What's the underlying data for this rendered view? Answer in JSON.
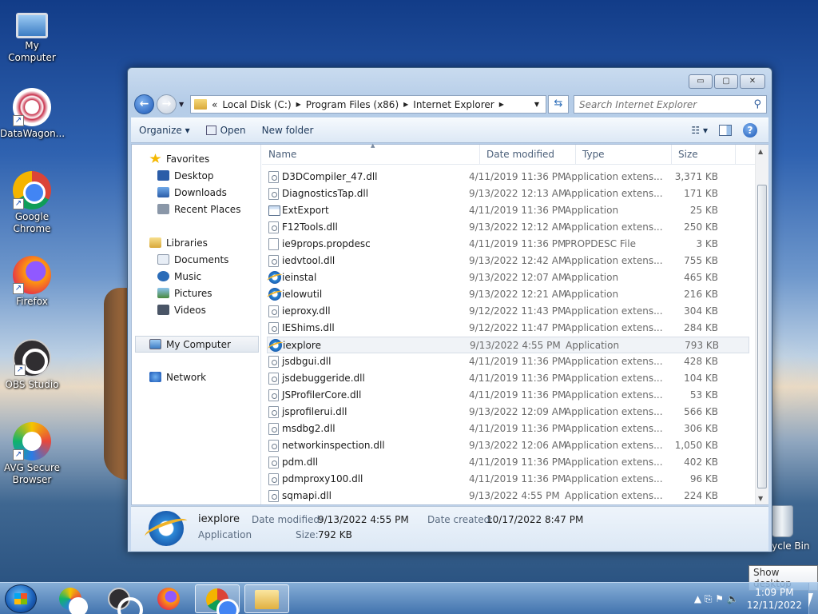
{
  "desktop": {
    "icons": [
      {
        "label": "My Computer"
      },
      {
        "label": "DataWagon..."
      },
      {
        "label": "Google Chrome"
      },
      {
        "label": "Firefox"
      },
      {
        "label": "OBS Studio"
      },
      {
        "label": "AVG Secure Browser"
      }
    ],
    "recycle_bin": "Recycle Bin"
  },
  "window": {
    "caption_buttons": {
      "minimize": "▭",
      "maximize": "▢",
      "close": "✕"
    },
    "address": {
      "overflow": "«",
      "crumbs": [
        "Local Disk (C:)",
        "Program Files (x86)",
        "Internet Explorer"
      ],
      "separator": "▶"
    },
    "search": {
      "placeholder": "Search Internet Explorer"
    },
    "toolbar": {
      "organize": "Organize ▾",
      "open": "Open",
      "new_folder": "New folder",
      "views": "☷ ▾",
      "help": "?"
    },
    "nav": {
      "favorites": "Favorites",
      "desktop": "Desktop",
      "downloads": "Downloads",
      "recent_places": "Recent Places",
      "libraries": "Libraries",
      "documents": "Documents",
      "music": "Music",
      "pictures": "Pictures",
      "videos": "Videos",
      "my_computer": "My Computer",
      "network": "Network"
    },
    "columns": {
      "name": "Name",
      "date_modified": "Date modified",
      "type": "Type",
      "size": "Size"
    },
    "files": [
      {
        "name": "D3DCompiler_47.dll",
        "date": "4/11/2019 11:36 PM",
        "type": "Application extens...",
        "size": "3,371 KB",
        "icon": "dll"
      },
      {
        "name": "DiagnosticsTap.dll",
        "date": "9/13/2022 12:13 AM",
        "type": "Application extens...",
        "size": "171 KB",
        "icon": "dll"
      },
      {
        "name": "ExtExport",
        "date": "4/11/2019 11:36 PM",
        "type": "Application",
        "size": "25 KB",
        "icon": "app"
      },
      {
        "name": "F12Tools.dll",
        "date": "9/13/2022 12:12 AM",
        "type": "Application extens...",
        "size": "250 KB",
        "icon": "dll"
      },
      {
        "name": "ie9props.propdesc",
        "date": "4/11/2019 11:36 PM",
        "type": "PROPDESC File",
        "size": "3 KB",
        "icon": "file"
      },
      {
        "name": "iedvtool.dll",
        "date": "9/13/2022 12:42 AM",
        "type": "Application extens...",
        "size": "755 KB",
        "icon": "dll"
      },
      {
        "name": "ieinstal",
        "date": "9/13/2022 12:07 AM",
        "type": "Application",
        "size": "465 KB",
        "icon": "ie"
      },
      {
        "name": "ielowutil",
        "date": "9/13/2022 12:21 AM",
        "type": "Application",
        "size": "216 KB",
        "icon": "ie"
      },
      {
        "name": "ieproxy.dll",
        "date": "9/12/2022 11:43 PM",
        "type": "Application extens...",
        "size": "304 KB",
        "icon": "dll"
      },
      {
        "name": "IEShims.dll",
        "date": "9/12/2022 11:47 PM",
        "type": "Application extens...",
        "size": "284 KB",
        "icon": "dll"
      },
      {
        "name": "iexplore",
        "date": "9/13/2022 4:55 PM",
        "type": "Application",
        "size": "793 KB",
        "icon": "ie",
        "selected": true
      },
      {
        "name": "jsdbgui.dll",
        "date": "4/11/2019 11:36 PM",
        "type": "Application extens...",
        "size": "428 KB",
        "icon": "dll"
      },
      {
        "name": "jsdebuggeride.dll",
        "date": "4/11/2019 11:36 PM",
        "type": "Application extens...",
        "size": "104 KB",
        "icon": "dll"
      },
      {
        "name": "JSProfilerCore.dll",
        "date": "4/11/2019 11:36 PM",
        "type": "Application extens...",
        "size": "53 KB",
        "icon": "dll"
      },
      {
        "name": "jsprofilerui.dll",
        "date": "9/13/2022 12:09 AM",
        "type": "Application extens...",
        "size": "566 KB",
        "icon": "dll"
      },
      {
        "name": "msdbg2.dll",
        "date": "4/11/2019 11:36 PM",
        "type": "Application extens...",
        "size": "306 KB",
        "icon": "dll"
      },
      {
        "name": "networkinspection.dll",
        "date": "9/13/2022 12:06 AM",
        "type": "Application extens...",
        "size": "1,050 KB",
        "icon": "dll"
      },
      {
        "name": "pdm.dll",
        "date": "4/11/2019 11:36 PM",
        "type": "Application extens...",
        "size": "402 KB",
        "icon": "dll"
      },
      {
        "name": "pdmproxy100.dll",
        "date": "4/11/2019 11:36 PM",
        "type": "Application extens...",
        "size": "96 KB",
        "icon": "dll"
      },
      {
        "name": "sqmapi.dll",
        "date": "9/13/2022 4:55 PM",
        "type": "Application extens...",
        "size": "224 KB",
        "icon": "dll"
      }
    ],
    "details": {
      "name": "iexplore",
      "type": "Application",
      "modified_label": "Date modified:",
      "modified_value": "9/13/2022 4:55 PM",
      "created_label": "Date created:",
      "created_value": "10/17/2022 8:47 PM",
      "size_label": "Size:",
      "size_value": "792 KB"
    }
  },
  "taskbar": {
    "time": "1:09 PM",
    "date": "12/11/2022",
    "tooltip": "Show desktop",
    "tray_icons": "▲  ⎘  ⚑  🔈"
  }
}
